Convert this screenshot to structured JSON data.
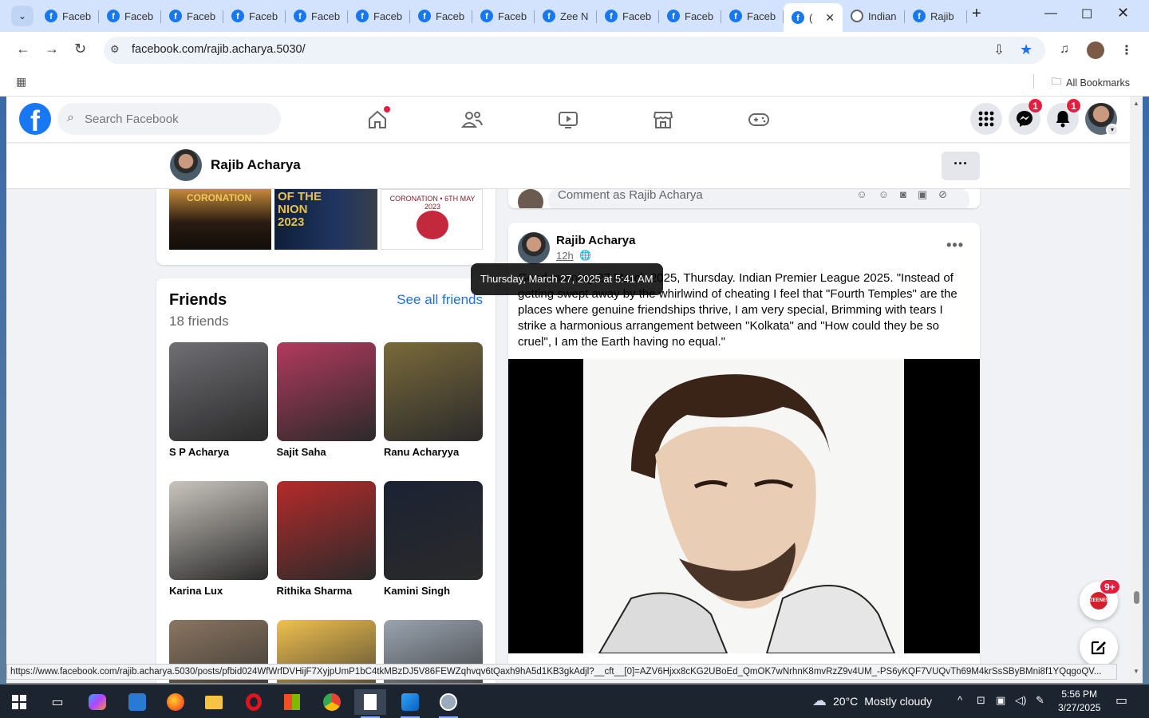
{
  "browser": {
    "tabs": [
      {
        "label": "Faceb",
        "icon": "facebook-icon"
      },
      {
        "label": "Faceb",
        "icon": "facebook-icon"
      },
      {
        "label": "Faceb",
        "icon": "facebook-icon"
      },
      {
        "label": "Faceb",
        "icon": "facebook-icon"
      },
      {
        "label": "Faceb",
        "icon": "facebook-icon"
      },
      {
        "label": "Faceb",
        "icon": "facebook-icon"
      },
      {
        "label": "Faceb",
        "icon": "facebook-icon"
      },
      {
        "label": "Faceb",
        "icon": "facebook-icon"
      },
      {
        "label": "Zee N",
        "icon": "facebook-icon"
      },
      {
        "label": "Faceb",
        "icon": "facebook-icon"
      },
      {
        "label": "Faceb",
        "icon": "facebook-icon"
      },
      {
        "label": "Faceb",
        "icon": "facebook-icon"
      },
      {
        "label": "(",
        "icon": "facebook-icon",
        "active": true
      },
      {
        "label": "Indian",
        "icon": "globe-icon"
      },
      {
        "label": "Rajib",
        "icon": "facebook-icon"
      }
    ],
    "url": "facebook.com/rajib.acharya.5030/",
    "bookmarks_label": "All Bookmarks"
  },
  "facebook": {
    "search_placeholder": "Search Facebook",
    "messenger_badge": "1",
    "notifications_badge": "1",
    "profile_name": "Rajib Acharya",
    "photos": [
      "CORONATION",
      "OF THE NION 2023",
      "CORONATION • 6TH MAY 2023"
    ],
    "friends": {
      "title": "Friends",
      "count": "18 friends",
      "see_all": "See all friends",
      "list": [
        {
          "name": "S P Acharya",
          "color": "#6f6f74"
        },
        {
          "name": "Sajit Saha",
          "color": "#b23a5e"
        },
        {
          "name": "Ranu Acharyya",
          "color": "#7a6a3a"
        },
        {
          "name": "Karina Lux",
          "color": "#c9c4bd"
        },
        {
          "name": "Rithika Sharma",
          "color": "#b52a2a"
        },
        {
          "name": "Kamini Singh",
          "color": "#1b2233"
        },
        {
          "name": "",
          "color": "#8a7560"
        },
        {
          "name": "",
          "color": "#f0c050"
        },
        {
          "name": "",
          "color": "#9aa4b0"
        }
      ]
    },
    "comment_placeholder": "Comment as Rajib Acharya",
    "post": {
      "author": "Rajib Acharya",
      "time": "12h",
      "text": "Good morning 27 March 2025, Thursday. Indian Premier League 2025. \"Instead of getting swept away by the whirlwind of cheating I feel that \"Fourth Temples\" are the places where genuine friendships thrive, I am very special, Brimming with tears I strike a harmonious arrangement between \"Kolkata\" and \"How could they be so cruel\", I am the Earth having no equal.\"",
      "tooltip": "Thursday, March 27, 2025 at 5:41 AM"
    },
    "zee_badge": "9+",
    "zee_label": "ZEENEWS"
  },
  "status_url": "https://www.facebook.com/rajib.acharya.5030/posts/pfbid024WfWrfDVHijF7XyjpUmP1bC4tkMBzDJ5V86FEWZqhvqv6tQaxh9hA5d1KB3gkAdjl?__cft__[0]=AZV6Hjxx8cKG2UBoEd_QmOK7wNrhnK8mvRzZ9v4UM_-PS6yKQF7VUQvTh69M4krSsSByBMni8f1YQqgoQV...",
  "taskbar": {
    "weather_temp": "20°C",
    "weather_text": "Mostly cloudy",
    "time": "5:56 PM",
    "date": "3/27/2025"
  },
  "colors": {
    "fb_blue": "#1877f2",
    "badge_red": "#e41e3f",
    "link_blue": "#216fdb"
  }
}
